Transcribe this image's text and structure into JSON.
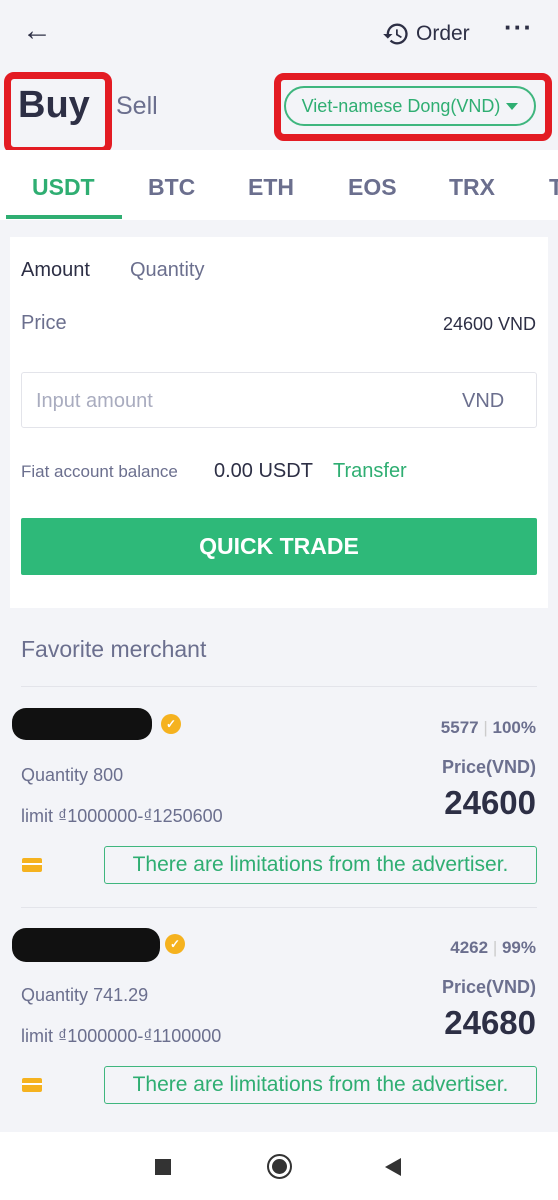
{
  "header": {
    "back_icon": "arrow-left-icon",
    "order_label": "Order",
    "order_icon": "history-icon",
    "more_icon": "more-dots-icon",
    "more_glyph": "···"
  },
  "mode": {
    "buy": "Buy",
    "sell": "Sell",
    "currency": "Viet-namese Dong(VND)"
  },
  "tabs": [
    "USDT",
    "BTC",
    "ETH",
    "EOS",
    "TRX",
    "T"
  ],
  "trade": {
    "amount_tab": "Amount",
    "quantity_tab": "Quantity",
    "price_label": "Price",
    "price_value": "24600 VND",
    "input_placeholder": "Input amount",
    "input_unit": "VND",
    "balance_label": "Fiat account balance",
    "balance_value": "0.00 USDT",
    "transfer": "Transfer",
    "quick_trade": "QUICK TRADE"
  },
  "favorites": {
    "title": "Favorite merchant",
    "merchants": [
      {
        "orders": "5577",
        "rate": "100%",
        "quantity_label": "Quantity",
        "quantity": "800",
        "limit_label": "limit",
        "limit": "₫1000000-₫1250600",
        "price_label": "Price(VND)",
        "price": "24600",
        "notice": "There are limitations from the advertiser."
      },
      {
        "orders": "4262",
        "rate": "99%",
        "quantity_label": "Quantity",
        "quantity": "741.29",
        "limit_label": "limit",
        "limit": "₫1000000-₫1100000",
        "price_label": "Price(VND)",
        "price": "24680",
        "notice": "There are limitations from the advertiser."
      }
    ]
  },
  "colors": {
    "accent": "#2fae72",
    "annotation": "#e31b23",
    "badge": "#f5b21f"
  }
}
